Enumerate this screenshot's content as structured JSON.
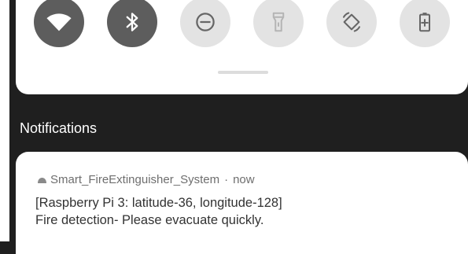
{
  "quick_settings": {
    "tiles": [
      {
        "icon": "wifi-icon",
        "state": "on"
      },
      {
        "icon": "bluetooth-icon",
        "state": "on"
      },
      {
        "icon": "do-not-disturb-icon",
        "state": "off"
      },
      {
        "icon": "flashlight-icon",
        "state": "off"
      },
      {
        "icon": "auto-rotate-icon",
        "state": "off"
      },
      {
        "icon": "battery-saver-icon",
        "state": "off"
      }
    ],
    "colors": {
      "active_tile": "#5d5d5d",
      "inactive_tile": "#e3e3e3",
      "inactive_glyph": "#b4b4b4"
    }
  },
  "notifications": {
    "heading": "Notifications",
    "items": [
      {
        "app_icon": "fire-extinguisher-app-icon",
        "app_name": "Smart_FireExtinguisher_System",
        "separator": "·",
        "time": "now",
        "line1": "[Raspberry Pi 3: latitude-36, longitude-128]",
        "line2": "Fire detection- Please evacuate quickly."
      }
    ]
  },
  "colors": {
    "background": "#1f1f1f",
    "card": "#ffffff"
  }
}
